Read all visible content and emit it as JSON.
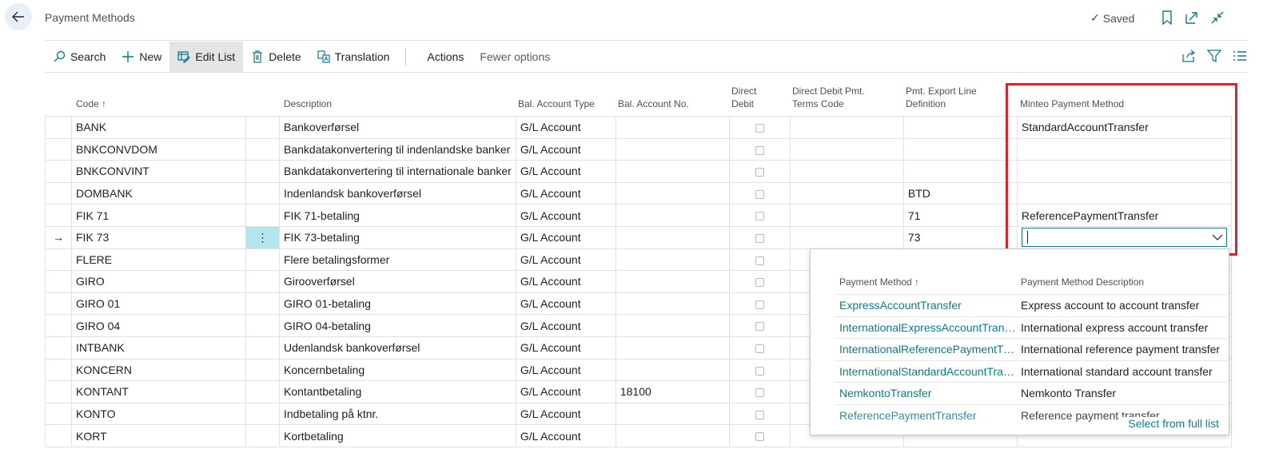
{
  "header": {
    "title": "Payment Methods",
    "saved_label": "Saved",
    "icons": [
      "back-arrow-icon",
      "bookmark-icon",
      "open-new-window-icon",
      "collapse-icon"
    ]
  },
  "actions": {
    "search": "Search",
    "new": "New",
    "edit_list": "Edit List",
    "delete": "Delete",
    "translation": "Translation",
    "actions": "Actions",
    "fewer_options": "Fewer options",
    "right_icons": [
      "share-icon",
      "filter-icon",
      "list-view-icon"
    ]
  },
  "columns": {
    "code": "Code ↑",
    "description": "Description",
    "bal_account_type": "Bal. Account Type",
    "bal_account_no": "Bal. Account No.",
    "direct_debit_1": "Direct",
    "direct_debit_2": "Debit",
    "dd_terms_1": "Direct Debit Pmt.",
    "dd_terms_2": "Terms Code",
    "pmt_export_1": "Pmt. Export Line",
    "pmt_export_2": "Definition",
    "minteo": "Minteo Payment Method"
  },
  "rows": [
    {
      "code": "BANK",
      "description": "Bankoverførsel",
      "type": "G/L Account",
      "acct_no": "",
      "export": "",
      "minteo": "StandardAccountTransfer"
    },
    {
      "code": "BNKCONVDOM",
      "description": "Bankdatakonvertering til indenlandske banker",
      "type": "G/L Account",
      "acct_no": "",
      "export": "",
      "minteo": ""
    },
    {
      "code": "BNKCONVINT",
      "description": "Bankdatakonvertering til internationale banker",
      "type": "G/L Account",
      "acct_no": "",
      "export": "",
      "minteo": ""
    },
    {
      "code": "DOMBANK",
      "description": "Indenlandsk bankoverførsel",
      "type": "G/L Account",
      "acct_no": "",
      "export": "BTD",
      "minteo": ""
    },
    {
      "code": "FIK 71",
      "description": "FIK 71-betaling",
      "type": "G/L Account",
      "acct_no": "",
      "export": "71",
      "minteo": "ReferencePaymentTransfer"
    },
    {
      "code": "FIK 73",
      "description": "FIK 73-betaling",
      "type": "G/L Account",
      "acct_no": "",
      "export": "73",
      "minteo": ""
    },
    {
      "code": "FLERE",
      "description": "Flere betalingsformer",
      "type": "G/L Account",
      "acct_no": "",
      "export": "",
      "minteo": ""
    },
    {
      "code": "GIRO",
      "description": "Girooverførsel",
      "type": "G/L Account",
      "acct_no": "",
      "export": "",
      "minteo": ""
    },
    {
      "code": "GIRO 01",
      "description": "GIRO 01-betaling",
      "type": "G/L Account",
      "acct_no": "",
      "export": "",
      "minteo": ""
    },
    {
      "code": "GIRO 04",
      "description": "GIRO 04-betaling",
      "type": "G/L Account",
      "acct_no": "",
      "export": "",
      "minteo": ""
    },
    {
      "code": "INTBANK",
      "description": "Udenlandsk bankoverførsel",
      "type": "G/L Account",
      "acct_no": "",
      "export": "",
      "minteo": ""
    },
    {
      "code": "KONCERN",
      "description": "Koncernbetaling",
      "type": "G/L Account",
      "acct_no": "",
      "export": "",
      "minteo": ""
    },
    {
      "code": "KONTANT",
      "description": "Kontantbetaling",
      "type": "G/L Account",
      "acct_no": "18100",
      "export": "",
      "minteo": ""
    },
    {
      "code": "KONTO",
      "description": "Indbetaling på ktnr.",
      "type": "G/L Account",
      "acct_no": "",
      "export": "",
      "minteo": ""
    },
    {
      "code": "KORT",
      "description": "Kortbetaling",
      "type": "G/L Account",
      "acct_no": "",
      "export": "",
      "minteo": ""
    }
  ],
  "current_row_marker": "→",
  "row_menu": "⋮",
  "dropdown": {
    "col_method": "Payment Method ↑",
    "col_desc": "Payment Method Description",
    "items": [
      {
        "method": "ExpressAccountTransfer",
        "desc": "Express account to account transfer"
      },
      {
        "method": "InternationalExpressAccountTransfer",
        "desc": "International express account transfer"
      },
      {
        "method": "InternationalReferencePaymentTra...",
        "desc": "International reference payment transfer"
      },
      {
        "method": "InternationalStandardAccountTran...",
        "desc": "International standard account transfer"
      },
      {
        "method": "NemkontoTransfer",
        "desc": "Nemkonto Transfer"
      },
      {
        "method": "ReferencePaymentTransfer",
        "desc": "Reference payment transfer"
      }
    ],
    "footer": "Select from full list"
  }
}
